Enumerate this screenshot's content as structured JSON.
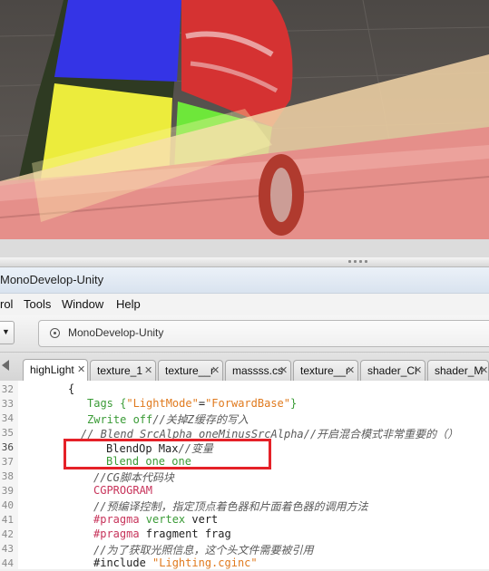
{
  "window": {
    "title": "MonoDevelop-Unity"
  },
  "menubar": {
    "items": [
      "rol",
      "Tools",
      "Window",
      "Help"
    ]
  },
  "toolbar": {
    "run_arrow": "▼",
    "status_text": "MonoDevelop-Unity"
  },
  "tabs": [
    {
      "label": "highLight",
      "active": true
    },
    {
      "label": "texture_1",
      "active": false
    },
    {
      "label": "texture__r",
      "active": false
    },
    {
      "label": "massss.cs",
      "active": false
    },
    {
      "label": "texture__r",
      "active": false
    },
    {
      "label": "shader_Cl",
      "active": false
    },
    {
      "label": "shader_M",
      "active": false
    }
  ],
  "editor": {
    "current_line": "36",
    "lines": [
      {
        "num": "32",
        "parts": [
          {
            "t": "{",
            "c": "plain"
          }
        ]
      },
      {
        "num": "33",
        "parts": [
          {
            "t": "Tags {",
            "c": "kw-green"
          },
          {
            "t": "\"LightMode\"",
            "c": "str-orange"
          },
          {
            "t": "=",
            "c": "plain"
          },
          {
            "t": "\"ForwardBase\"",
            "c": "str-orange"
          },
          {
            "t": "}",
            "c": "kw-green"
          }
        ]
      },
      {
        "num": "34",
        "parts": [
          {
            "t": "Zwrite off",
            "c": "kw-green"
          },
          {
            "t": "//关掉Z缓存的写入",
            "c": "cmt"
          }
        ]
      },
      {
        "num": "35",
        "parts": [
          {
            "t": "// Blend SrcAlpha oneMinusSrcAlpha//开启混合模式非常重要的（）",
            "c": "cmt"
          }
        ]
      },
      {
        "num": "36",
        "parts": [
          {
            "t": "BlendOp Max",
            "c": "plain"
          },
          {
            "t": "//变量",
            "c": "cmt"
          }
        ]
      },
      {
        "num": "37",
        "parts": [
          {
            "t": "Blend one one",
            "c": "kw-green"
          }
        ]
      },
      {
        "num": "38",
        "parts": [
          {
            "t": "//CG脚本代码块",
            "c": "cmt"
          }
        ]
      },
      {
        "num": "39",
        "parts": [
          {
            "t": "CGPROGRAM",
            "c": "mag"
          }
        ]
      },
      {
        "num": "40",
        "parts": [
          {
            "t": "//预编译控制，指定顶点着色器和片面着色器的调用方法",
            "c": "cmt"
          }
        ]
      },
      {
        "num": "41",
        "parts": [
          {
            "t": "#pragma ",
            "c": "mag"
          },
          {
            "t": "vertex ",
            "c": "kw-green"
          },
          {
            "t": "vert",
            "c": "plain"
          }
        ]
      },
      {
        "num": "42",
        "parts": [
          {
            "t": "#pragma ",
            "c": "mag"
          },
          {
            "t": "fragment frag",
            "c": "plain"
          }
        ]
      },
      {
        "num": "43",
        "parts": [
          {
            "t": "//为了获取光照信息，这个头文件需要被引用",
            "c": "cmt"
          }
        ]
      },
      {
        "num": "44",
        "parts": [
          {
            "t": "#include ",
            "c": "plain"
          },
          {
            "t": "\"Lighting.cginc\"",
            "c": "str-orange"
          }
        ]
      }
    ]
  },
  "colors": {
    "highlight_box": "#e52128",
    "keyword": "#3a9b36",
    "string": "#e07a1e",
    "directive": "#c7335a"
  }
}
